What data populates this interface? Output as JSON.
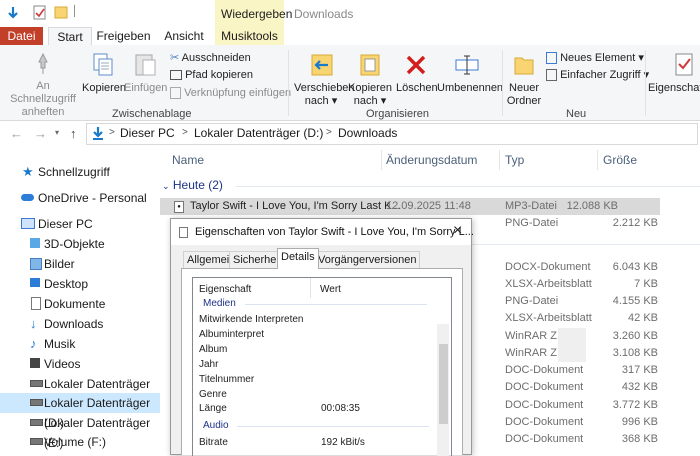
{
  "window": {
    "title": "Downloads"
  },
  "ribbon_tabs": [
    {
      "label": "Datei"
    },
    {
      "label": "Start"
    },
    {
      "label": "Freigeben"
    },
    {
      "label": "Ansicht"
    },
    {
      "label": "Musiktools"
    }
  ],
  "contextual_tab": {
    "label": "Wiedergeben"
  },
  "ribbon": {
    "pin": "An Schnellzugriff anheften",
    "copy": "Kopieren",
    "paste": "Einfügen",
    "cut": "Ausschneiden",
    "copy_path": "Pfad kopieren",
    "paste_shortcut": "Verknüpfung einfügen",
    "group_clipboard": "Zwischenablage",
    "move_to": "Verschieben nach",
    "copy_to": "Kopieren nach",
    "delete": "Löschen",
    "rename": "Umbenennen",
    "group_organize": "Organisieren",
    "new_folder": "Neuer Ordner",
    "new_item": "Neues Element",
    "easy_access": "Einfacher Zugriff",
    "group_new": "Neu",
    "properties": "Eigenschaften"
  },
  "address": {
    "crumbs": [
      "Dieser PC",
      "Lokaler Datenträger (D:)",
      "Downloads"
    ],
    "sep": ">"
  },
  "nav": [
    {
      "label": "Schnellzugriff"
    },
    {
      "label": "OneDrive - Personal"
    },
    {
      "label": "Dieser PC"
    },
    {
      "label": "3D-Objekte"
    },
    {
      "label": "Bilder"
    },
    {
      "label": "Desktop"
    },
    {
      "label": "Dokumente"
    },
    {
      "label": "Downloads"
    },
    {
      "label": "Musik"
    },
    {
      "label": "Videos"
    },
    {
      "label": "Lokaler Datenträger (C:)"
    },
    {
      "label": "Lokaler Datenträger (D:)"
    },
    {
      "label": "Lokaler Datenträger (E:)"
    },
    {
      "label": "Volume (F:)"
    }
  ],
  "columns": {
    "name": "Name",
    "date": "Änderungsdatum",
    "type": "Typ",
    "size": "Größe"
  },
  "group": {
    "label": "Heute (2)"
  },
  "files": [
    {
      "name": "Taylor Swift - I Love You, I'm Sorry  Last K...",
      "date": "12.09.2025 11:48",
      "type": "MP3-Datei",
      "size": "12.088 KB"
    },
    {
      "name": "",
      "date": "",
      "type": "PNG-Datei",
      "size": "2.212 KB"
    },
    {
      "name": "",
      "date": "",
      "type": "DOCX-Dokument",
      "size": "6.043 KB"
    },
    {
      "name": "",
      "date": "",
      "type": "XLSX-Arbeitsblatt",
      "size": "7 KB"
    },
    {
      "name": "",
      "date": "",
      "type": "PNG-Datei",
      "size": "4.155 KB"
    },
    {
      "name": "",
      "date": "",
      "type": "XLSX-Arbeitsblatt",
      "size": "42 KB"
    },
    {
      "name": "",
      "date": "",
      "type": "WinRAR ZIP",
      "size": "3.260 KB"
    },
    {
      "name": "",
      "date": "",
      "type": "WinRAR ZIP",
      "size": "3.108 KB"
    },
    {
      "name": "",
      "date": "",
      "type": "DOC-Dokument",
      "size": "317 KB"
    },
    {
      "name": "",
      "date": "",
      "type": "DOC-Dokument",
      "size": "432 KB"
    },
    {
      "name": "",
      "date": "",
      "type": "DOC-Dokument",
      "size": "3.772 KB"
    },
    {
      "name": "",
      "date": "",
      "type": "DOC-Dokument",
      "size": "996 KB"
    },
    {
      "name": "",
      "date": "",
      "type": "DOC-Dokument",
      "size": "368 KB"
    }
  ],
  "dialog": {
    "title": "Eigenschaften von Taylor Swift - I Love You, I'm Sorry  L...",
    "close": "×",
    "tabs": [
      "Allgemein",
      "Sicherheit",
      "Details",
      "Vorgängerversionen"
    ],
    "header_prop": "Eigenschaft",
    "header_val": "Wert",
    "section_media": "Medien",
    "section_audio": "Audio",
    "props": [
      {
        "name": "Mitwirkende Interpreten",
        "value": ""
      },
      {
        "name": "Albuminterpret",
        "value": ""
      },
      {
        "name": "Album",
        "value": ""
      },
      {
        "name": "Jahr",
        "value": ""
      },
      {
        "name": "Titelnummer",
        "value": ""
      },
      {
        "name": "Genre",
        "value": ""
      },
      {
        "name": "Länge",
        "value": "00:08:35"
      }
    ],
    "bitrate": {
      "name": "Bitrate",
      "value": "192 kBit/s"
    }
  },
  "colors": {
    "accent": "#1979ca",
    "file_tab": "#c2402a",
    "context_tab": "#faf5c4",
    "selection": "#cce8ff"
  }
}
